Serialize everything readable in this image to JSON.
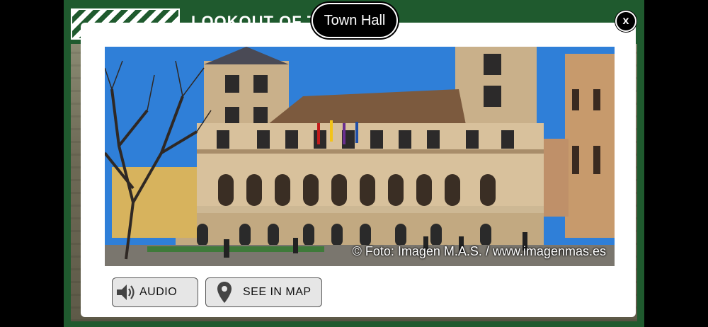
{
  "background_app": {
    "title": "LOOKOUT OF TH"
  },
  "modal": {
    "title": "Town Hall",
    "close_label": "x",
    "photo_credit": "© Foto: Imagen M.A.S. / www.imagenmas.es",
    "buttons": {
      "audio_label": "AUDIO",
      "map_label": "SEE IN MAP"
    }
  },
  "colors": {
    "app_background": "#1f5a2e",
    "sky": "#2f7fd8",
    "button_background": "#e6e6e6"
  },
  "icons": {
    "audio": "speaker-icon",
    "map": "map-pin-icon",
    "close": "close-icon"
  }
}
